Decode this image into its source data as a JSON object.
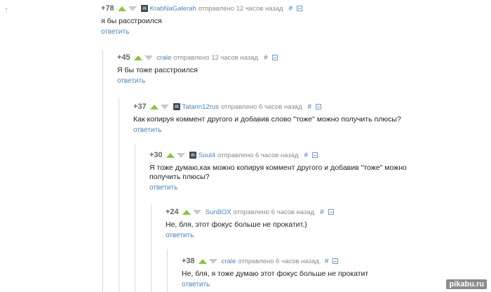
{
  "page": {
    "back_arrow": "↑",
    "watermark": "pikabu.ru"
  },
  "icons": {
    "vote_up": "triangle-up",
    "vote_down": "triangle-down",
    "collapse": "minus-box"
  },
  "colors": {
    "link": "#4d82b8",
    "upvote": "#8cc24b",
    "downvote": "#c9c9c9"
  },
  "comments": [
    {
      "score": "+78",
      "author": "KrabNaGalerah",
      "sent": "отправлено 12 часов назад",
      "hash": "#",
      "text": "я бы расстроился",
      "reply": "ответить"
    },
    {
      "score": "+45",
      "author": "crale",
      "sent": "отправлено 12 часов назад",
      "hash": "#",
      "text": "Я бы тоже расстроился",
      "reply": "ответить"
    },
    {
      "score": "+37",
      "author": "Tatarin12rus",
      "sent": "отправлено 6 часов назад",
      "hash": "#",
      "text": "Как копируя коммент другого и добавив слово \"тоже\" можно получить плюсы?",
      "reply": "ответить"
    },
    {
      "score": "+30",
      "author": "Soul4",
      "sent": "отправлено 6 часов назад",
      "hash": "#",
      "text": "Я тоже думаю,как можно копируя коммент другого и добавив \"тоже\" можно получить плюсы?",
      "reply": "ответить"
    },
    {
      "score": "+24",
      "author": "SunBOX",
      "sent": "отправлено 6 часов назад",
      "hash": "#",
      "text": "Не, бля, этот фокус больше не прокатит.)",
      "reply": "ответить"
    },
    {
      "score": "+38",
      "author": "crale",
      "sent": "отправлено 6 часов назад",
      "hash": "#",
      "text": "Не, бля, я тоже думаю этот фокус больше не прокатит",
      "reply": "ответить"
    }
  ]
}
